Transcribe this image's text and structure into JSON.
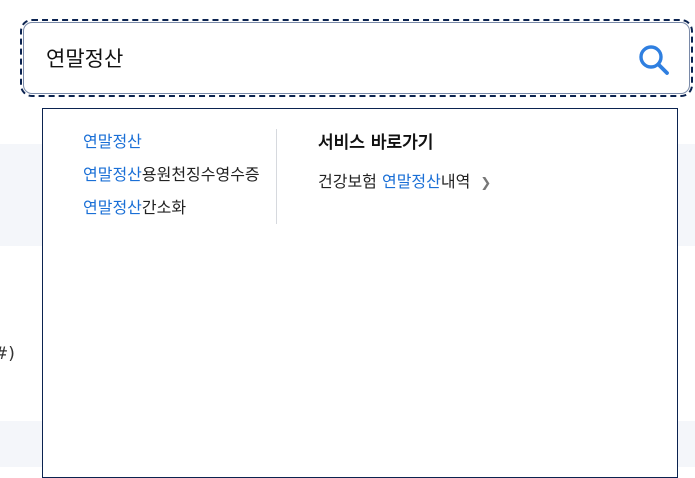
{
  "search": {
    "query": "연말정산"
  },
  "background": {
    "edge_text": "#)"
  },
  "suggestions": [
    {
      "highlight": "연말정산",
      "rest": ""
    },
    {
      "highlight": "연말정산",
      "rest": "용원천징수영수증"
    },
    {
      "highlight": "연말정산",
      "rest": "간소화"
    }
  ],
  "quick_links": {
    "title": "서비스 바로가기",
    "items": [
      {
        "prefix": "건강보험 ",
        "highlight": "연말정산",
        "suffix": "내역"
      }
    ]
  },
  "colors": {
    "highlight": "#1a6fd6",
    "border": "#0b2350",
    "search_icon": "#2f7fe0"
  },
  "icons": {
    "search": "search-icon",
    "chevron": "chevron-right-icon"
  }
}
